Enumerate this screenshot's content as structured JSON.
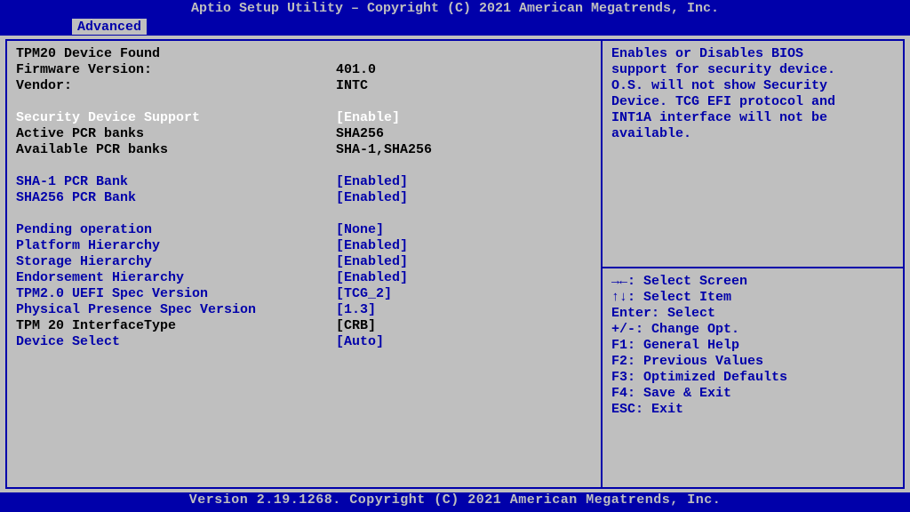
{
  "header": "Aptio Setup Utility – Copyright (C) 2021 American Megatrends, Inc.",
  "tab": "Advanced",
  "footer": "Version 2.19.1268. Copyright (C) 2021 American Megatrends, Inc.",
  "info": {
    "device_found": "TPM20 Device Found",
    "fw_label": "Firmware Version:",
    "fw_value": "401.0",
    "vendor_label": "Vendor:",
    "vendor_value": "INTC",
    "active_pcr_label": "Active PCR banks",
    "active_pcr_value": "SHA256",
    "avail_pcr_label": "Available PCR banks",
    "avail_pcr_value": "SHA-1,SHA256",
    "iface_label": "TPM 20 InterfaceType",
    "iface_value": "[CRB]"
  },
  "selected": {
    "label": "Security Device Support",
    "value": "[Enable]"
  },
  "options": {
    "sha1_label": "SHA-1 PCR Bank",
    "sha1_value": "[Enabled]",
    "sha256_label": "SHA256 PCR Bank",
    "sha256_value": "[Enabled]",
    "pending_label": "Pending operation",
    "pending_value": "[None]",
    "plat_label": "Platform Hierarchy",
    "plat_value": "[Enabled]",
    "stor_label": "Storage Hierarchy",
    "stor_value": "[Enabled]",
    "endo_label": "Endorsement Hierarchy",
    "endo_value": "[Enabled]",
    "uefi_label": "TPM2.0 UEFI Spec Version",
    "uefi_value": "[TCG_2]",
    "pps_label": "Physical Presence Spec Version",
    "pps_value": "[1.3]",
    "devsel_label": "Device Select",
    "devsel_value": "[Auto]"
  },
  "help": {
    "l1": "Enables or Disables BIOS",
    "l2": "support for security device.",
    "l3": "O.S. will not show Security",
    "l4": "Device. TCG EFI protocol and",
    "l5": "INT1A interface will not be",
    "l6": "available."
  },
  "keys": {
    "k1": "→←: Select Screen",
    "k2": "↑↓: Select Item",
    "k3": "Enter: Select",
    "k4": "+/-: Change Opt.",
    "k5": "F1: General Help",
    "k6": "F2: Previous Values",
    "k7": "F3: Optimized Defaults",
    "k8": "F4: Save & Exit",
    "k9": "ESC: Exit"
  }
}
